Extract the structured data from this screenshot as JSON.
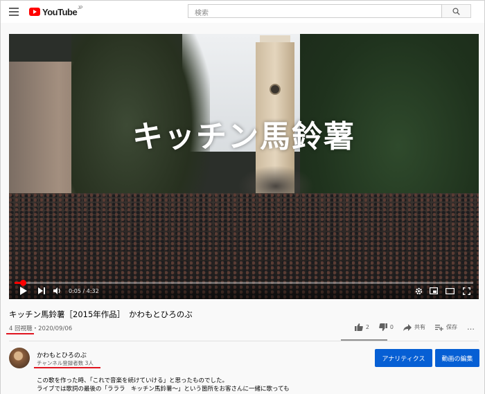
{
  "header": {
    "logo_text": "YouTube",
    "logo_region": "JP",
    "search_placeholder": "検索"
  },
  "player": {
    "overlay_title": "キッチン馬鈴薯",
    "current_time": "0:05",
    "duration": "4:32",
    "time_display": "0:05 / 4:32",
    "progress_fraction": 0.018
  },
  "video": {
    "title": "キッチン馬鈴薯［2015年作品］　かわもとひろのぶ",
    "views": "4 回視聴",
    "separator": "・",
    "date": "2020/09/06",
    "likes": "2",
    "dislikes": "0",
    "share_label": "共有",
    "save_label": "保存",
    "more_label": "…"
  },
  "channel": {
    "name": "かわもとひろのぶ",
    "subscribers": "チャンネル登録者数 3人",
    "analytics_button": "アナリティクス",
    "edit_button": "動画の編集"
  },
  "description": {
    "line1": "この歌を作った時、「これで音楽を続けていける」と思ったものでした。",
    "line2": "ライブでは歌詞の最後の「ラララ　キッチン馬鈴薯～」という箇所をお客さんに一緒に歌っても"
  },
  "colors": {
    "youtube_red": "#ff0000",
    "primary_blue": "#065fd4",
    "annotation_red": "#e0141f"
  }
}
